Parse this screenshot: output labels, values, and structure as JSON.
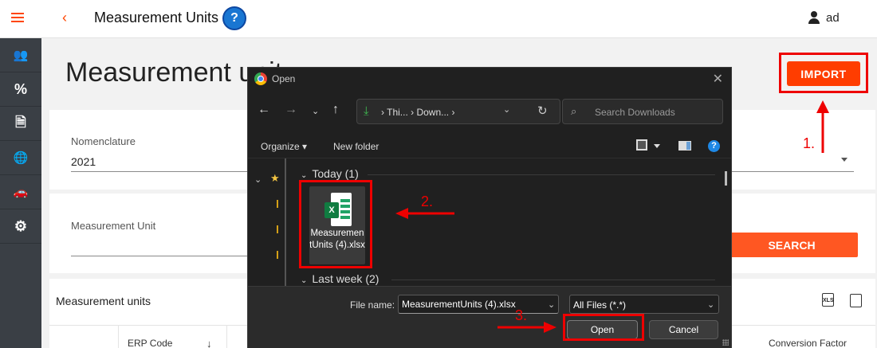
{
  "header": {
    "title": "Measurement Units",
    "help_icon": "help-circle-icon",
    "help_glyph": "?",
    "user_name": "ad"
  },
  "sidebar": {
    "items": [
      {
        "icon": "users-icon",
        "glyph": "👥"
      },
      {
        "icon": "percent-icon",
        "glyph": "%"
      },
      {
        "icon": "document-icon",
        "glyph": "🗎"
      },
      {
        "icon": "globe-icon",
        "glyph": "🌐"
      },
      {
        "icon": "car-icon",
        "glyph": "🚗"
      },
      {
        "icon": "gear-icon",
        "glyph": "⚙"
      }
    ]
  },
  "main": {
    "heading": "Measurement unit",
    "import_label": "IMPORT",
    "nomenclature_label": "Nomenclature",
    "nomenclature_value": "2021",
    "measurement_unit_label": "Measurement Unit",
    "search_label": "SEARCH",
    "table_title": "Measurement units",
    "columns": [
      "ERP Code",
      "Conversion Factor"
    ]
  },
  "dialog": {
    "title": "Open",
    "breadcrumb": "›  Thi...  ›  Down...  ›",
    "search_placeholder": "Search Downloads",
    "organize_label": "Organize ▾",
    "new_folder_label": "New folder",
    "groups": [
      {
        "label": "Today (1)"
      },
      {
        "label": "Last week (2)"
      }
    ],
    "file": {
      "name": "MeasurementUnits (4).xlsx",
      "badge": "X"
    },
    "file_name_label": "File name:",
    "file_name_value": "MeasurementUnits (4).xlsx",
    "filter_value": "All Files (*.*)",
    "open_label": "Open",
    "cancel_label": "Cancel"
  },
  "annotations": {
    "step1": "1.",
    "step2": "2.",
    "step3": "3.",
    "color": "#e00000"
  },
  "colors": {
    "accent": "#ff3d00",
    "sidebar": "#3a3f45",
    "dialog_bg": "#202020"
  }
}
